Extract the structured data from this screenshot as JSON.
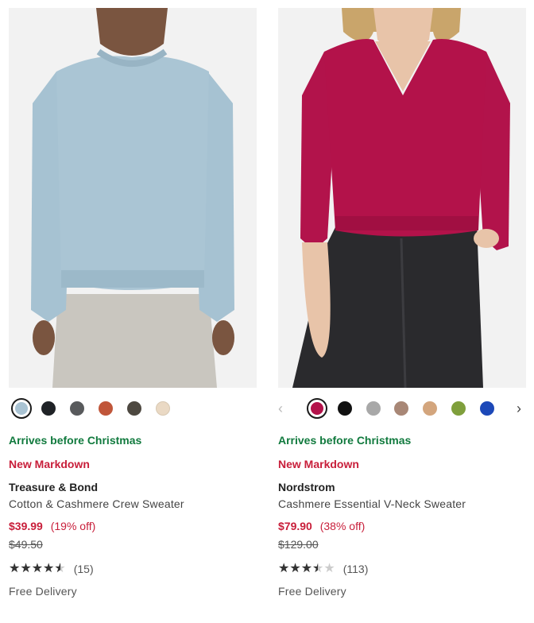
{
  "products": [
    {
      "brand": "Treasure & Bond",
      "name": "Cotton & Cashmere Crew Sweater",
      "delivery_promo": "Arrives before Christmas",
      "badge": "New Markdown",
      "sale_price": "$39.99",
      "discount": "(19% off)",
      "original_price": "$49.50",
      "rating": 4.5,
      "review_count": "(15)",
      "shipping": "Free Delivery",
      "swatches": [
        "#a9c3d3",
        "#1f2226",
        "#585a5c",
        "#c0563a",
        "#4d4840",
        "#ead9c4"
      ],
      "selected_swatch": 0
    },
    {
      "brand": "Nordstrom",
      "name": "Cashmere Essential V-Neck Sweater",
      "delivery_promo": "Arrives before Christmas",
      "badge": "New Markdown",
      "sale_price": "$79.90",
      "discount": "(38% off)",
      "original_price": "$129.00",
      "rating": 3.5,
      "review_count": "(113)",
      "shipping": "Free Delivery",
      "swatches": [
        "#b3124a",
        "#111111",
        "#a8a8a8",
        "#a88776",
        "#d3a57d",
        "#7f9f3c",
        "#1c48b8"
      ],
      "selected_swatch": 0
    }
  ],
  "icons": {
    "prev": "chevron-left-icon",
    "next": "chevron-right-icon",
    "star": "star-icon"
  },
  "glyphs": {
    "prev": "‹",
    "next": "›",
    "stars": "★★★★★"
  }
}
